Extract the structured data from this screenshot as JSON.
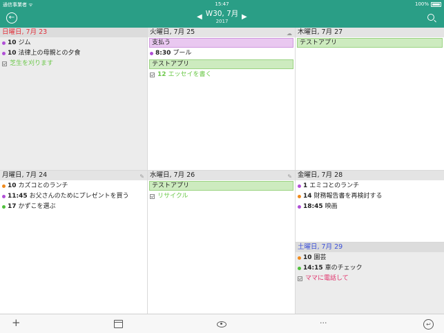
{
  "status_bar": {
    "carrier": "通信事業者 ᯤ",
    "time": "15:47",
    "battery": "100%"
  },
  "nav": {
    "back_icon": "back-circle-icon",
    "title": "W30, 7月",
    "subtitle": "2017",
    "prev_icon": "◀",
    "next_icon": "▶",
    "search_icon": "search-icon"
  },
  "days": {
    "sun": {
      "label": "日曜日, 7月 23",
      "events": [
        {
          "time": "10",
          "title": "ジム",
          "color": "#b04fd6"
        },
        {
          "time": "10",
          "title": "法律上の母親との夕食",
          "color": "#b04fd6"
        }
      ],
      "tasks": [
        {
          "title": "芝生を刈ります",
          "color": "#6cc84a"
        }
      ]
    },
    "tue": {
      "label": "火曜日, 7月 25",
      "allday_top": {
        "title": "支払う",
        "bg": "#e9c8f0",
        "border": "#cf97de"
      },
      "events": [
        {
          "time": "8:30",
          "title": "プール",
          "color": "#b04fd6"
        }
      ],
      "allday_mid": {
        "title": "テストアプリ",
        "bg": "#cdebbf",
        "border": "#9ad381"
      },
      "tasks": [
        {
          "time": "12",
          "title": "エッセイを書く",
          "color": "#6cc84a"
        }
      ]
    },
    "thu": {
      "label": "木曜日, 7月 27",
      "allday": {
        "title": "テストアプリ",
        "bg": "#cdebbf",
        "border": "#9ad381"
      }
    },
    "mon": {
      "label": "月曜日, 7月 24",
      "events": [
        {
          "time": "10",
          "title": "カズコとのランチ",
          "color": "#f08a1c"
        },
        {
          "time": "11:45",
          "title": "お父さんのためにプレゼントを買う",
          "color": "#b04fd6"
        },
        {
          "time": "17",
          "title": "かずこを選ぶ",
          "color": "#4fbf3a"
        }
      ]
    },
    "wed": {
      "label": "水曜日, 7月 26",
      "allday": {
        "title": "テストアプリ",
        "bg": "#cdebbf",
        "border": "#9ad381"
      },
      "tasks": [
        {
          "title": "リサイクル",
          "color": "#6cc84a"
        }
      ]
    },
    "fri": {
      "label": "金曜日, 7月 28",
      "events": [
        {
          "time": "1",
          "title": "エミコとのランチ",
          "color": "#b04fd6"
        },
        {
          "time": "14",
          "title": "財務報告書を再検討する",
          "color": "#f08a1c"
        },
        {
          "time": "18:45",
          "title": "映画",
          "color": "#b04fd6"
        }
      ]
    },
    "sat": {
      "label": "土曜日, 7月 29",
      "events": [
        {
          "time": "10",
          "title": "園芸",
          "color": "#f08a1c"
        },
        {
          "time": "14:15",
          "title": "車のチェック",
          "color": "#4fbf3a"
        }
      ],
      "tasks": [
        {
          "title": "ママに電話して",
          "color": "#e0306a"
        }
      ]
    }
  },
  "toolbar": {
    "add": "+",
    "calendar_icon": "calendar-icon",
    "eye_icon": "eye-icon",
    "more": "···",
    "today_icon": "today-icon"
  },
  "colors": {
    "accent": "#2a9e86",
    "sunday": "#e0303a",
    "saturday": "#3a4fd8"
  }
}
